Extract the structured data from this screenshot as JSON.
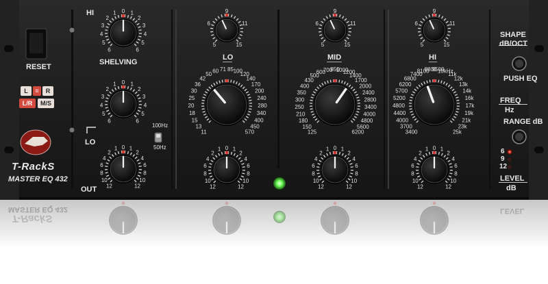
{
  "brand": {
    "name": "T-RackS",
    "product": "MASTER EQ 432"
  },
  "colors": {
    "panel": "#1d1d1d",
    "accent_red": "#d63a34",
    "led_green": "#6fff5a",
    "text": "#e8e8e8"
  },
  "left": {
    "reset_label": "RESET",
    "stereo_buttons": [
      "L",
      "=",
      "R",
      "L/R",
      "M/S"
    ],
    "out_label": "OUT"
  },
  "shelving": {
    "hi_label": "HI",
    "lo_label": "LO",
    "shelving_label": "SHELVING",
    "switch_top": "100Hz",
    "switch_bottom": "50Hz"
  },
  "level_scale": [
    "12",
    "10",
    "8",
    "6",
    "4",
    "2",
    "1",
    "0",
    "1",
    "2",
    "4",
    "6",
    "8",
    "10",
    "12"
  ],
  "gain_scale": [
    "6",
    "5",
    "4",
    "3",
    "2",
    "1",
    "0",
    "1",
    "2",
    "3",
    "4",
    "5",
    "6"
  ],
  "shape_scale": [
    "5",
    "6",
    "9",
    "11",
    "15"
  ],
  "bands": {
    "lo": {
      "label": "LO",
      "freqs": [
        "11",
        "13",
        "15",
        "18",
        "20",
        "25",
        "30",
        "36",
        "42",
        "50",
        "60",
        "71",
        "85",
        "100",
        "120",
        "140",
        "170",
        "200",
        "240",
        "280",
        "340",
        "400",
        "450",
        "570"
      ]
    },
    "mid": {
      "label": "MID",
      "freqs": [
        "125",
        "150",
        "180",
        "210",
        "250",
        "300",
        "350",
        "400",
        "430",
        "500",
        "600",
        "700",
        "850",
        "1000",
        "1200",
        "1400",
        "1700",
        "2000",
        "2400",
        "2800",
        "3400",
        "4000",
        "4800",
        "5600",
        "6200"
      ]
    },
    "hi": {
      "label": "HI",
      "freqs": [
        "3400",
        "3700",
        "4000",
        "4400",
        "4800",
        "5200",
        "5700",
        "6200",
        "6800",
        "7400",
        "8100",
        "8800",
        "9500",
        "10kHz",
        "11k",
        "12k",
        "13k",
        "14k",
        "16k",
        "17k",
        "19k",
        "21k",
        "23k",
        "25k"
      ]
    }
  },
  "right": {
    "shape_label": "SHAPE",
    "shape_unit": "dB/OCT",
    "push_eq_label": "PUSH EQ",
    "freq_label": "FREQ",
    "freq_unit": "Hz",
    "range_label": "RANGE dB",
    "range_values": [
      "6",
      "9",
      "12"
    ],
    "range_selected": "6",
    "level_label": "LEVEL",
    "level_unit": "dB"
  }
}
